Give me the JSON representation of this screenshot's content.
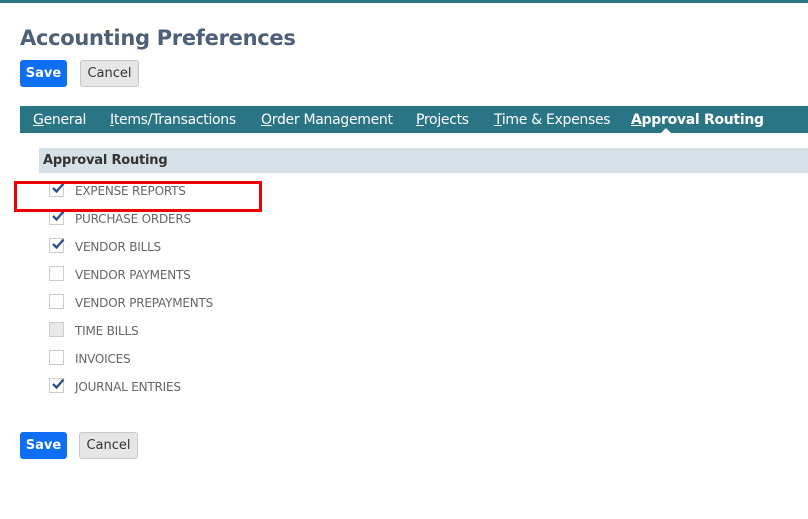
{
  "page": {
    "title": "Accounting Preferences"
  },
  "buttons": {
    "save": "Save",
    "cancel": "Cancel"
  },
  "tabs": [
    {
      "label": "General",
      "active": false
    },
    {
      "label": "Items/Transactions",
      "active": false
    },
    {
      "label": "Order Management",
      "active": false
    },
    {
      "label": "Projects",
      "active": false
    },
    {
      "label": "Time & Expenses",
      "active": false
    },
    {
      "label": "Approval Routing",
      "active": true
    }
  ],
  "section": {
    "title": "Approval Routing"
  },
  "options": [
    {
      "label": "EXPENSE REPORTS",
      "checked": true,
      "disabled": false,
      "highlighted": true
    },
    {
      "label": "PURCHASE ORDERS",
      "checked": true,
      "disabled": false
    },
    {
      "label": "VENDOR BILLS",
      "checked": true,
      "disabled": false
    },
    {
      "label": "VENDOR PAYMENTS",
      "checked": false,
      "disabled": false
    },
    {
      "label": "VENDOR PREPAYMENTS",
      "checked": false,
      "disabled": false
    },
    {
      "label": "TIME BILLS",
      "checked": false,
      "disabled": true
    },
    {
      "label": "INVOICES",
      "checked": false,
      "disabled": false
    },
    {
      "label": "JOURNAL ENTRIES",
      "checked": true,
      "disabled": false
    }
  ],
  "colors": {
    "accent": "#2a7585",
    "primary_button": "#0f6ff4",
    "highlight": "#ee0000",
    "check": "#2d4f8c"
  }
}
